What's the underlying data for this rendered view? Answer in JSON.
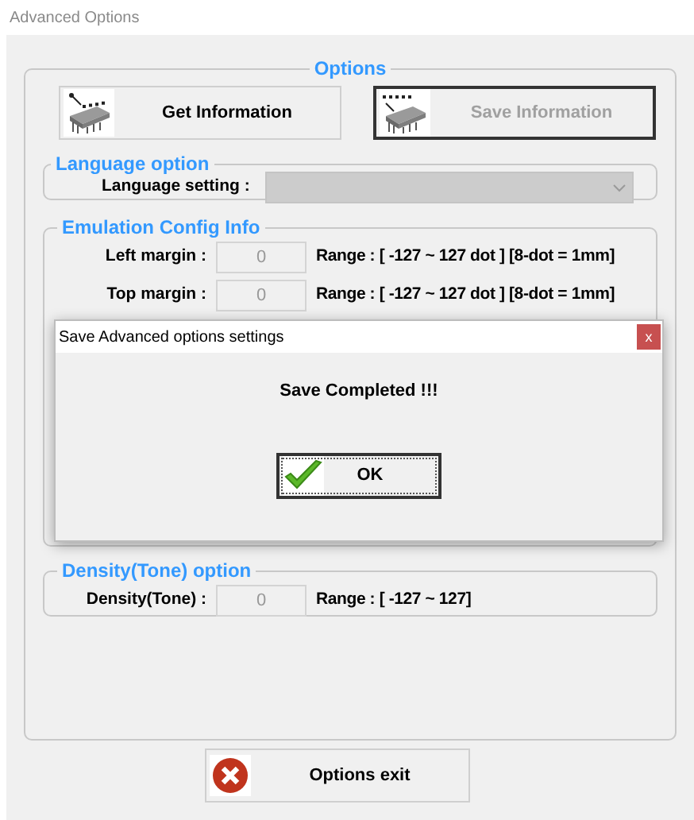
{
  "window": {
    "title": "Advanced Options"
  },
  "options": {
    "title": "Options",
    "buttons": [
      {
        "label": "Get Information",
        "disabled": false,
        "focused": false
      },
      {
        "label": "Save Information",
        "disabled": true,
        "focused": true
      }
    ]
  },
  "language": {
    "title": "Language option",
    "label": "Language setting :",
    "disabled": true
  },
  "emulation": {
    "title": "Emulation Config Info",
    "rows": [
      {
        "label": "Left margin :",
        "value": "0",
        "range": "Range : [ -127 ~ 127 dot ] [8-dot = 1mm]"
      },
      {
        "label": "Top margin :",
        "value": "0",
        "range": "Range : [ -127 ~ 127 dot ] [8-dot = 1mm]"
      }
    ]
  },
  "density": {
    "title": "Density(Tone) option",
    "label": "Density(Tone) :",
    "value": "0",
    "range": "Range : [ -127 ~ 127]"
  },
  "exit_button": {
    "label": "Options exit"
  },
  "dialog": {
    "title": "Save Advanced options settings",
    "close": "x",
    "message": "Save Completed !!!",
    "button": "OK"
  }
}
